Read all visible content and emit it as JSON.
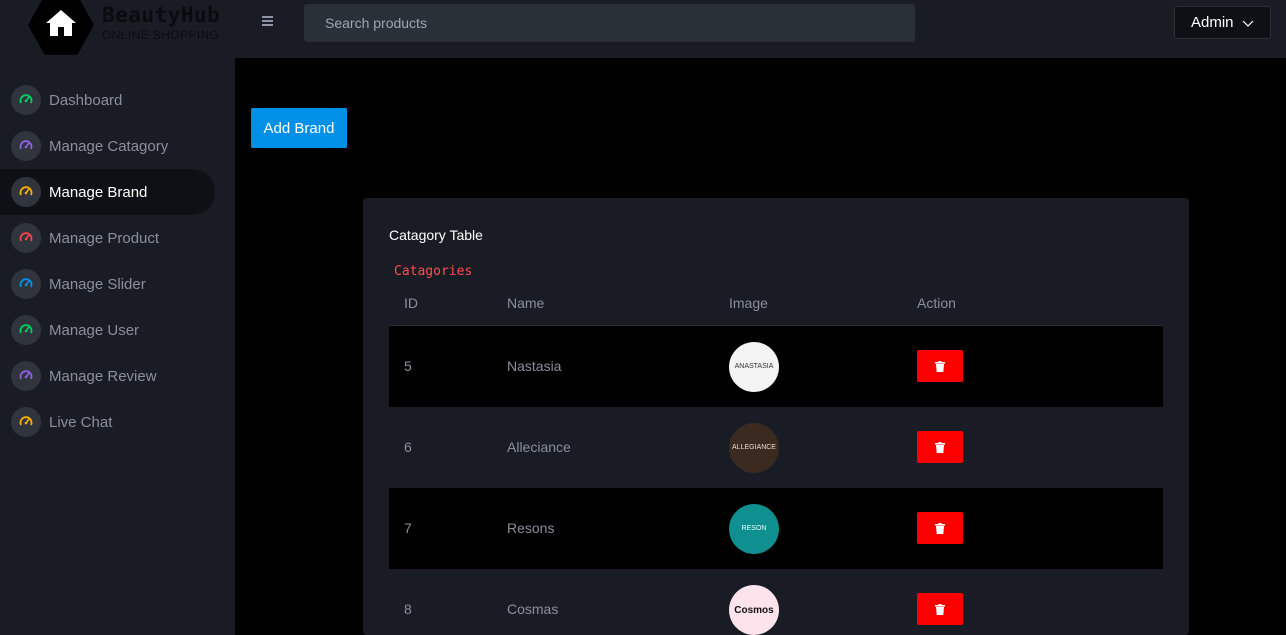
{
  "app": {
    "logo_title": "BeautyHub",
    "logo_subtitle": "ONLINE SHOPPING"
  },
  "header": {
    "search_placeholder": "Search products",
    "user_menu_label": "Admin"
  },
  "sidebar": {
    "items": [
      {
        "label": "Dashboard",
        "icon": "speedometer-icon",
        "color": "#00d25b"
      },
      {
        "label": "Manage Catagory",
        "icon": "speedometer-icon",
        "color": "#8f5fe8"
      },
      {
        "label": "Manage Brand",
        "icon": "speedometer-icon",
        "color": "#ffab00",
        "active": true
      },
      {
        "label": "Manage Product",
        "icon": "speedometer-icon",
        "color": "#fc424a"
      },
      {
        "label": "Manage Slider",
        "icon": "speedometer-icon",
        "color": "#0090e7"
      },
      {
        "label": "Manage User",
        "icon": "speedometer-icon",
        "color": "#00d25b"
      },
      {
        "label": "Manage Review",
        "icon": "speedometer-icon",
        "color": "#8f5fe8"
      },
      {
        "label": "Live Chat",
        "icon": "speedometer-icon",
        "color": "#ffab00"
      }
    ]
  },
  "main": {
    "add_button_label": "Add Brand",
    "card_title": "Catagory Table",
    "card_subtitle": "Catagories",
    "columns": [
      "ID",
      "Name",
      "Image",
      "Action"
    ],
    "rows": [
      {
        "id": "5",
        "name": "Nastasia",
        "image_text": "ANASTASIA",
        "image_bg": "#f3f3f3",
        "image_fg": "#333333"
      },
      {
        "id": "6",
        "name": "Alleciance",
        "image_text": "ALLEGIANCE",
        "image_bg": "#3b2a20",
        "image_fg": "#e8dccf"
      },
      {
        "id": "7",
        "name": "Resons",
        "image_text": "RESON",
        "image_bg": "#0f8f8f",
        "image_fg": "#e8ffff"
      },
      {
        "id": "8",
        "name": "Cosmas",
        "image_text": "Cosmos",
        "image_bg": "#fde3ec",
        "image_fg": "#111111"
      }
    ]
  },
  "colors": {
    "accent": "#0090e7",
    "danger": "#fc0000",
    "subtitle": "#ff4d4d"
  }
}
